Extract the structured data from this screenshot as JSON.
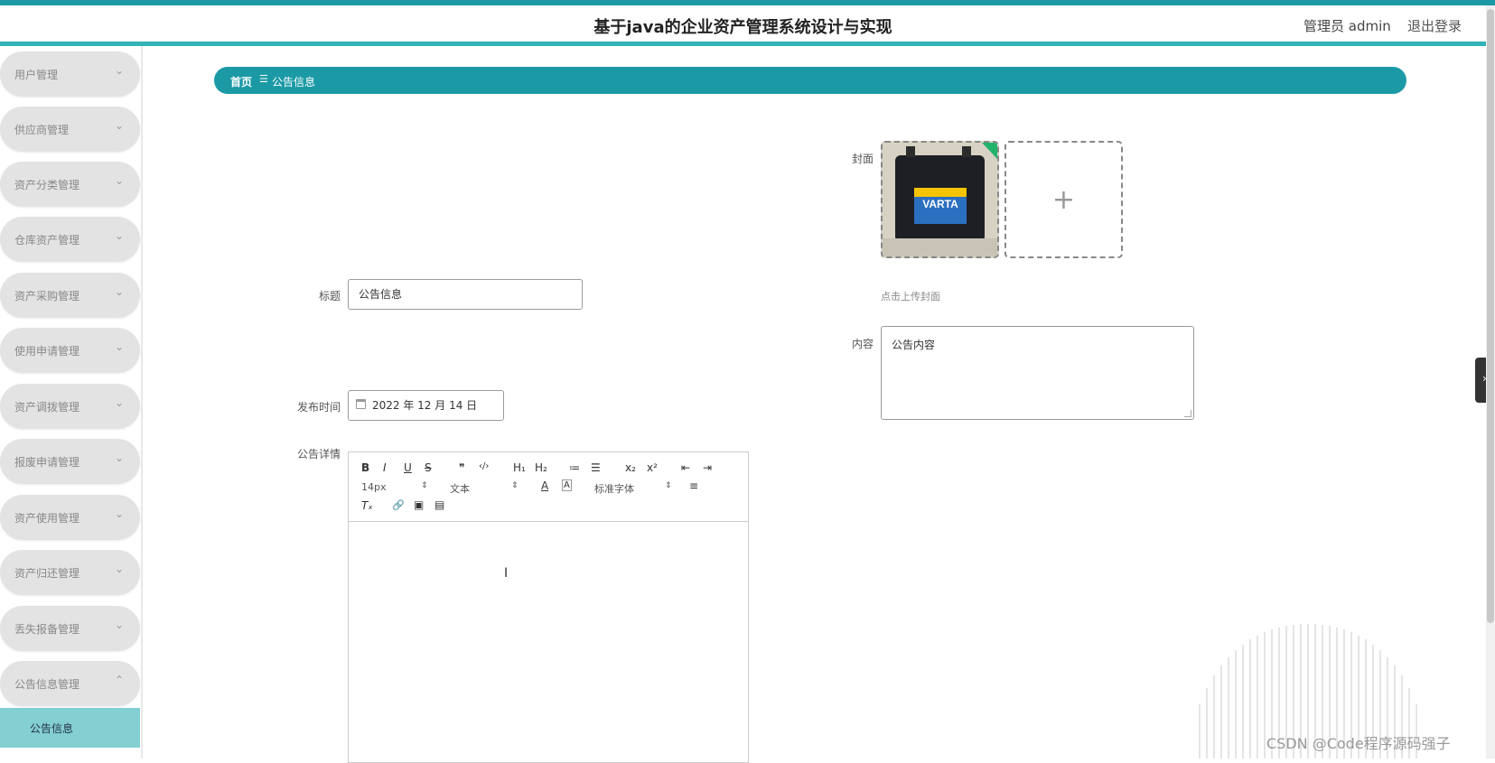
{
  "header": {
    "title": "基于java的企业资产管理系统设计与实现",
    "user": "管理员 admin",
    "logout": "退出登录"
  },
  "sidebar": {
    "items": [
      {
        "label": "用户管理",
        "chevron": "⌄"
      },
      {
        "label": "供应商管理",
        "chevron": "⌄"
      },
      {
        "label": "资产分类管理",
        "chevron": "⌄"
      },
      {
        "label": "仓库资产管理",
        "chevron": "⌄"
      },
      {
        "label": "资产采购管理",
        "chevron": "⌄"
      },
      {
        "label": "使用申请管理",
        "chevron": "⌄"
      },
      {
        "label": "资产调拨管理",
        "chevron": "⌄"
      },
      {
        "label": "报废申请管理",
        "chevron": "⌄"
      },
      {
        "label": "资产使用管理",
        "chevron": "⌄"
      },
      {
        "label": "资产归还管理",
        "chevron": "⌄"
      },
      {
        "label": "丢失报备管理",
        "chevron": "⌄"
      },
      {
        "label": "公告信息管理",
        "chevron": "⌃"
      }
    ],
    "active_sub": "公告信息"
  },
  "breadcrumb": {
    "home": "首页",
    "sep": "☰",
    "current": "公告信息"
  },
  "form": {
    "title_label": "标题",
    "title_value": "公告信息",
    "time_label": "发布时间",
    "time_value": "2022 年 12 月 14 日",
    "detail_label": "公告详情",
    "cover_label": "封面",
    "cover_hint": "点击上传封面",
    "cover_image_text": "VARTA",
    "upload_plus": "+",
    "content_label": "内容",
    "content_value": "公告内容"
  },
  "editor": {
    "font_size": "14px",
    "block_type": "文本",
    "font_family": "标准字体",
    "buttons": {
      "bold": "B",
      "italic": "I",
      "underline": "U",
      "strike": "S",
      "quote": "❞",
      "code": "‹/›",
      "h1": "H₁",
      "h2": "H₂",
      "ol": "≔",
      "ul": "☰",
      "sub": "x₂",
      "sup": "x²",
      "outdent": "⇤",
      "indent": "⇥",
      "color": "A",
      "bg": "A",
      "align": "≡",
      "clean": "Tₓ",
      "link": "🔗",
      "image": "▣",
      "video": "▤"
    }
  },
  "right_tab": "›",
  "watermark": "CSDN @Code程序源码强子",
  "colors": {
    "accent": "#1b9aa6",
    "sub_active": "#83cfd2"
  }
}
